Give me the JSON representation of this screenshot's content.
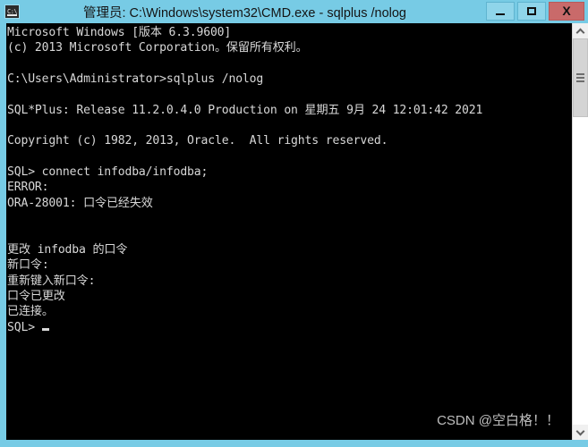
{
  "window": {
    "title": "管理员: C:\\Windows\\system32\\CMD.exe - sqlplus  /nolog",
    "icon": "cmd-console-icon",
    "titlebar_color": "#77cbe5",
    "console_bg": "#000000",
    "console_fg": "#d8d8d8",
    "close_button_color": "#c96a6a"
  },
  "controls": {
    "minimize_label": "–",
    "maximize_label": "□",
    "close_label": "X"
  },
  "console": {
    "lines": [
      "Microsoft Windows [版本 6.3.9600]",
      "(c) 2013 Microsoft Corporation。保留所有权利。",
      "",
      "C:\\Users\\Administrator>sqlplus /nolog",
      "",
      "SQL*Plus: Release 11.2.0.4.0 Production on 星期五 9月 24 12:01:42 2021",
      "",
      "Copyright (c) 1982, 2013, Oracle.  All rights reserved.",
      "",
      "SQL> connect infodba/infodba;",
      "ERROR:",
      "ORA-28001: 口令已经失效",
      "",
      "",
      "更改 infodba 的口令",
      "新口令:",
      "重新键入新口令:",
      "口令已更改",
      "已连接。",
      "SQL> "
    ],
    "cursor_line_index": 19
  },
  "watermark": {
    "text": "CSDN @空白格！！"
  },
  "scrollbar": {
    "up_arrow": "scroll-up-arrow",
    "down_arrow": "scroll-down-arrow",
    "thumb": "scroll-thumb"
  }
}
